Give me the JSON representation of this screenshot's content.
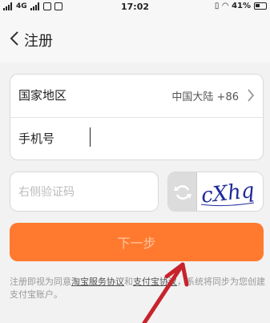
{
  "status_bar": {
    "carrier1_network": "ıll",
    "network_type": "4G",
    "carrier2_network": "ıll",
    "time": "17:02",
    "battery_percent": "41%"
  },
  "nav": {
    "title": "注册"
  },
  "form": {
    "region_label": "国家地区",
    "region_value": "中国大陆 +86",
    "phone_label": "手机号",
    "phone_value": "",
    "code_placeholder": "右侧验证码",
    "captcha_text": "cXhq"
  },
  "next_button": {
    "label": "下一步"
  },
  "agreement": {
    "prefix": "注册即视为同意",
    "link1": "淘宝服务协议",
    "middle": "和",
    "link2": "支付宝协议",
    "suffix": "，系统将同步为您创建支付宝账户。"
  },
  "colors": {
    "accent": "#ff7a2f",
    "annotation_arrow": "#c8232c"
  }
}
